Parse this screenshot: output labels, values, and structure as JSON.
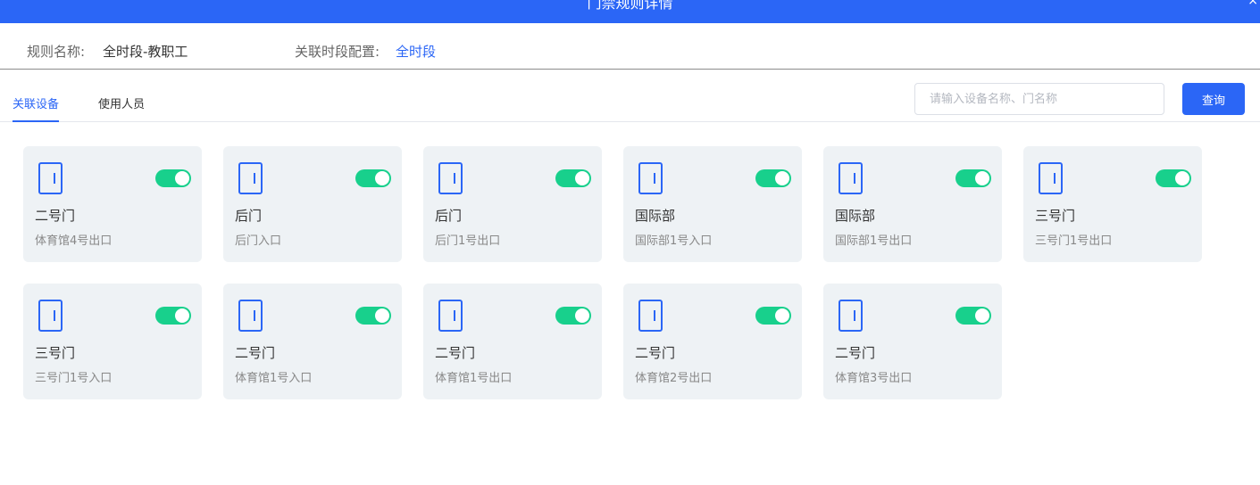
{
  "dialog": {
    "title": "门禁规则详情",
    "close_glyph": "×"
  },
  "info": {
    "rule_name_label": "规则名称:",
    "rule_name_value": "全时段-教职工",
    "period_label": "关联时段配置:",
    "period_value": "全时段"
  },
  "tabs": [
    {
      "label": "关联设备",
      "active": true
    },
    {
      "label": "使用人员",
      "active": false
    }
  ],
  "search": {
    "placeholder": "请输入设备名称、门名称",
    "value": ""
  },
  "query_label": "查询",
  "colors": {
    "accent": "#2b66f6",
    "toggle_on": "#18d08c",
    "card_bg": "#eef2f5"
  },
  "icons": {
    "door": "door-icon"
  },
  "devices": [
    {
      "name": "二号门",
      "sub": "体育馆4号出口",
      "enabled": true
    },
    {
      "name": "后门",
      "sub": "后门入口",
      "enabled": true
    },
    {
      "name": "后门",
      "sub": "后门1号出口",
      "enabled": true
    },
    {
      "name": "国际部",
      "sub": "国际部1号入口",
      "enabled": true
    },
    {
      "name": "国际部",
      "sub": "国际部1号出口",
      "enabled": true
    },
    {
      "name": "三号门",
      "sub": "三号门1号出口",
      "enabled": true
    },
    {
      "name": "三号门",
      "sub": "三号门1号入口",
      "enabled": true
    },
    {
      "name": "二号门",
      "sub": "体育馆1号入口",
      "enabled": true
    },
    {
      "name": "二号门",
      "sub": "体育馆1号出口",
      "enabled": true
    },
    {
      "name": "二号门",
      "sub": "体育馆2号出口",
      "enabled": true
    },
    {
      "name": "二号门",
      "sub": "体育馆3号出口",
      "enabled": true
    }
  ]
}
